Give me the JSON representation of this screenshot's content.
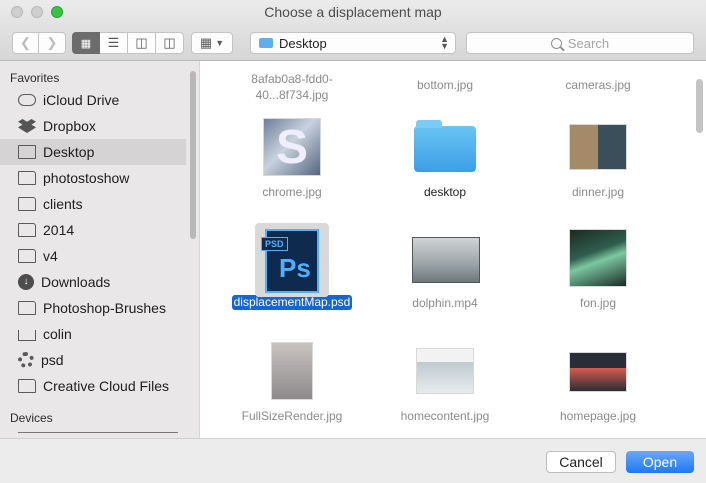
{
  "window": {
    "title": "Choose a displacement map"
  },
  "toolbar": {
    "back_icon": "chevron-left-icon",
    "forward_icon": "chevron-right-icon",
    "path_label": "Desktop",
    "search_placeholder": "Search"
  },
  "sidebar": {
    "favorites_header": "Favorites",
    "items": [
      {
        "label": "iCloud Drive",
        "icon": "cloud-icon"
      },
      {
        "label": "Dropbox",
        "icon": "dropbox-icon"
      },
      {
        "label": "Desktop",
        "icon": "desktop-icon",
        "selected": true
      },
      {
        "label": "photostoshow",
        "icon": "folder-icon"
      },
      {
        "label": "clients",
        "icon": "folder-icon"
      },
      {
        "label": "2014",
        "icon": "folder-icon"
      },
      {
        "label": "v4",
        "icon": "folder-icon"
      },
      {
        "label": "Downloads",
        "icon": "download-icon"
      },
      {
        "label": "Photoshop-Brushes",
        "icon": "folder-icon"
      },
      {
        "label": "colin",
        "icon": "home-icon"
      },
      {
        "label": "psd",
        "icon": "gear-icon"
      },
      {
        "label": "Creative Cloud Files",
        "icon": "folder-icon"
      }
    ],
    "devices_header": "Devices"
  },
  "files": [
    {
      "name": "8afab0a8-fdd0-40...8f734.jpg"
    },
    {
      "name": "bottom.jpg"
    },
    {
      "name": "cameras.jpg"
    },
    {
      "name": "chrome.jpg"
    },
    {
      "name": "desktop"
    },
    {
      "name": "dinner.jpg"
    },
    {
      "name": "displacementMap.psd",
      "selected": true
    },
    {
      "name": "dolphin.mp4"
    },
    {
      "name": "fon.jpg"
    },
    {
      "name": "FullSizeRender.jpg"
    },
    {
      "name": "homecontent.jpg"
    },
    {
      "name": "homepage.jpg"
    }
  ],
  "buttons": {
    "cancel": "Cancel",
    "open": "Open"
  },
  "colors": {
    "accent": "#1f78f2",
    "selection": "#1565d3",
    "zoom": "#36c445"
  }
}
